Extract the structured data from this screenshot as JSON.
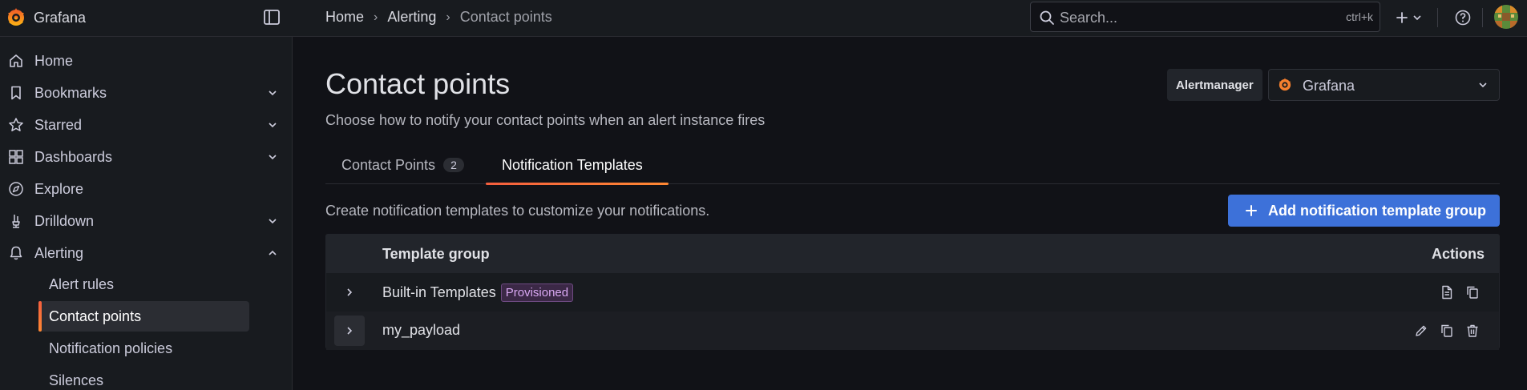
{
  "app": {
    "name": "Grafana"
  },
  "breadcrumb": [
    "Home",
    "Alerting",
    "Contact points"
  ],
  "search": {
    "placeholder": "Search...",
    "shortcut": "ctrl+k"
  },
  "sidebar": {
    "items": [
      {
        "label": "Home",
        "icon": "home-icon"
      },
      {
        "label": "Bookmarks",
        "icon": "bookmark-icon",
        "expandable": true
      },
      {
        "label": "Starred",
        "icon": "star-icon",
        "expandable": true
      },
      {
        "label": "Dashboards",
        "icon": "apps-icon",
        "expandable": true
      },
      {
        "label": "Explore",
        "icon": "compass-icon"
      },
      {
        "label": "Drilldown",
        "icon": "drilldown-icon",
        "expandable": true
      },
      {
        "label": "Alerting",
        "icon": "bell-icon",
        "expanded": true
      }
    ],
    "alerting_children": [
      "Alert rules",
      "Contact points",
      "Notification policies",
      "Silences"
    ],
    "active": "Contact points"
  },
  "page": {
    "title": "Contact points",
    "subtitle": "Choose how to notify your contact points when an alert instance fires"
  },
  "alertmanager": {
    "label": "Alertmanager",
    "value": "Grafana"
  },
  "tabs": [
    {
      "label": "Contact Points",
      "count": "2"
    },
    {
      "label": "Notification Templates",
      "active": true
    }
  ],
  "templates": {
    "info": "Create notification templates to customize your notifications.",
    "add_button": "Add notification template group",
    "columns": {
      "group": "Template group",
      "actions": "Actions"
    },
    "rows": [
      {
        "name": "Built-in Templates",
        "badge": "Provisioned",
        "actions": [
          "view-icon",
          "copy-icon"
        ]
      },
      {
        "name": "my_payload",
        "actions": [
          "edit-icon",
          "copy-icon",
          "delete-icon"
        ]
      }
    ]
  },
  "colors": {
    "accent_orange": "#f55f3e",
    "primary_blue": "#3d71d9",
    "background": "#111217"
  }
}
